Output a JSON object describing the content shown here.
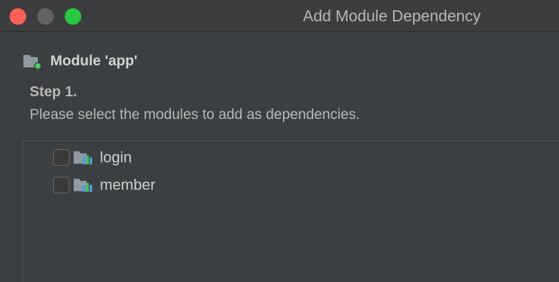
{
  "window": {
    "title": "Add Module Dependency",
    "controls": [
      "close",
      "minimize",
      "zoom"
    ]
  },
  "module": {
    "icon": "module-folder-icon",
    "label": "Module 'app'"
  },
  "step": {
    "title": "Step 1.",
    "description": "Please select the modules to add as dependencies."
  },
  "modules_list": {
    "items": [
      {
        "label": "login",
        "checked": false,
        "icon": "library-module-icon"
      },
      {
        "label": "member",
        "checked": false,
        "icon": "library-module-icon"
      }
    ]
  },
  "colors": {
    "close": "#fe5f57",
    "minimize": "#616264",
    "zoom": "#28c840",
    "background": "#3c3f41",
    "module_dot": "#4bd05c",
    "bar_blue": "#4a9fd8",
    "bar_green": "#4bbf5b"
  }
}
